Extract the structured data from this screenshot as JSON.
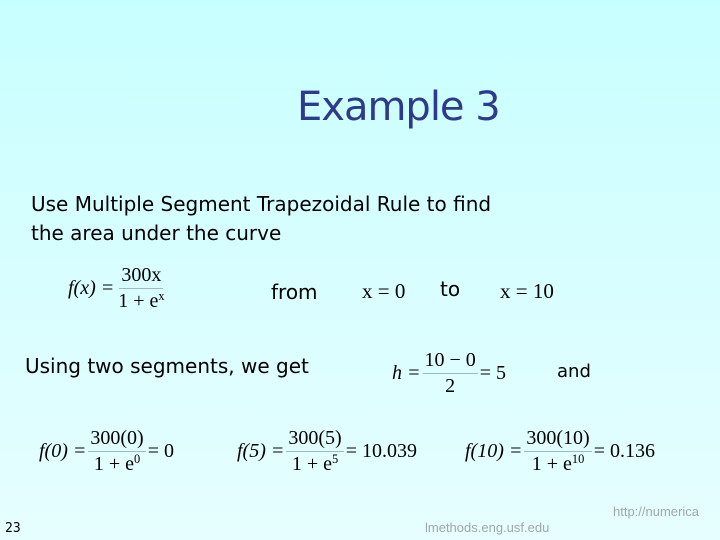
{
  "slide": {
    "title": "Example 3",
    "intro_line1": "Use Multiple Segment Trapezoidal Rule to find",
    "intro_line2": "the area under the curve",
    "function": {
      "lhs": "f(x) =",
      "numerator": "300x",
      "denominator_base": "1 + e",
      "denominator_exp": "x"
    },
    "from_label": "from",
    "lower_limit": "x = 0",
    "to_label": "to",
    "upper_limit": "x = 10",
    "using_text": "Using two segments, we get",
    "h_eq": {
      "lhs": "h =",
      "numerator": "10 − 0",
      "denominator": "2",
      "result": "= 5"
    },
    "and_label": "and",
    "evaluations": [
      {
        "lhs": "f(0) =",
        "numerator": "300(0)",
        "den_base": "1 + e",
        "den_exp": "0",
        "result": "= 0"
      },
      {
        "lhs": "f(5) =",
        "numerator": "300(5)",
        "den_base": "1 + e",
        "den_exp": "5",
        "result": "= 10.039"
      },
      {
        "lhs": "f(10) =",
        "numerator": "300(10)",
        "den_base": "1 + e",
        "den_exp": "10",
        "result": "= 0.136"
      }
    ],
    "slide_number": "23",
    "footer_url_line1": "http://numerica",
    "footer_url_line2": "lmethods.eng.usf.edu"
  }
}
